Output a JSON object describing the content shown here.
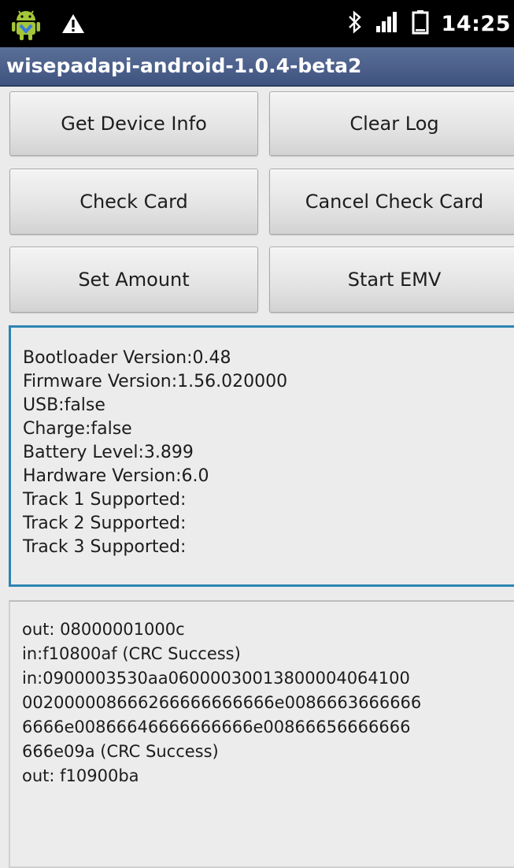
{
  "status_bar": {
    "time": "14:25",
    "icons": [
      "android-robot-icon",
      "warning-icon",
      "bluetooth-icon",
      "signal-icon",
      "battery-icon"
    ]
  },
  "title_bar": {
    "title": "wisepadapi-android-1.0.4-beta2",
    "color": "#4a5f8c"
  },
  "buttons": {
    "get_device_info": "Get Device Info",
    "clear_log": "Clear Log",
    "check_card": "Check Card",
    "cancel_check_card": "Cancel Check Card",
    "set_amount": "Set Amount",
    "start_emv": "Start EMV"
  },
  "status_panel": {
    "border_color": "#2c85b3",
    "lines": [
      "Bootloader Version:0.48",
      "Firmware Version:1.56.020000",
      "USB:false",
      "Charge:false",
      "Battery Level:3.899",
      "Hardware Version:6.0",
      "Track 1 Supported:",
      "Track 2 Supported:",
      "Track 3 Supported:"
    ]
  },
  "log_panel": {
    "lines": [
      "out: 08000001000c",
      "in:f10800af (CRC Success)",
      "in:0900003530aa060000300138000040641​00",
      "002000008666266666666666e0086663666666",
      "6666e00866646666666666e00866656666666",
      "666e09a (CRC Success)",
      "out: f10900ba"
    ]
  }
}
